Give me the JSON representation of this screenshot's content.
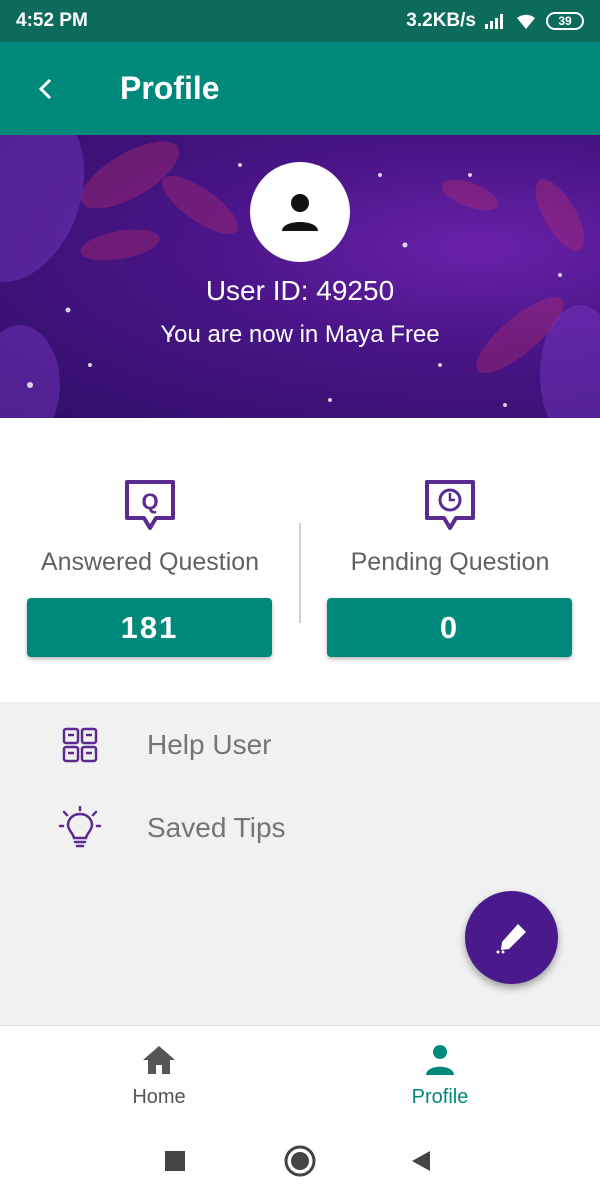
{
  "status_bar": {
    "time": "4:52 PM",
    "network_speed": "3.2KB/s",
    "battery": "39"
  },
  "app_bar": {
    "title": "Profile",
    "back_icon": "chevron-left-icon"
  },
  "profile": {
    "user_id": "User ID: 49250",
    "plan": "You are now in Maya Free",
    "avatar_icon": "person-icon"
  },
  "stats": {
    "answered": {
      "label": "Answered Question",
      "value": "181",
      "icon": "question-bubble-icon"
    },
    "pending": {
      "label": "Pending Question",
      "value": "0",
      "icon": "clock-bubble-icon"
    }
  },
  "menu": [
    {
      "label": "Help User",
      "icon": "helping-hands-icon"
    },
    {
      "label": "Saved Tips",
      "icon": "lightbulb-icon"
    }
  ],
  "fab": {
    "icon": "pencil-icon"
  },
  "bottom_nav": [
    {
      "label": "Home",
      "icon": "home-icon",
      "active": false
    },
    {
      "label": "Profile",
      "icon": "person-icon",
      "active": true
    }
  ],
  "colors": {
    "primary": "#00897b",
    "status_bar": "#0d6b5c",
    "accent_purple": "#4a1a8c",
    "icon_purple": "#5b2a91"
  }
}
